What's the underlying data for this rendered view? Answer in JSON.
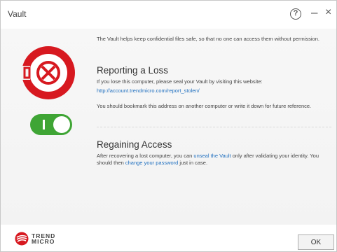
{
  "window": {
    "title": "Vault"
  },
  "titlebar": {
    "help": "?",
    "minimize": "–",
    "close": "×"
  },
  "intro": "The Vault helps keep confidential files safe, so that no one can access them without permission.",
  "reporting": {
    "heading": "Reporting a Loss",
    "text": "If you lose this computer, please seal your Vault by visiting this website:",
    "url": "http://account.trendmicro.com/report_stolen/",
    "note": "You should bookmark this address on another computer or write it down for future reference."
  },
  "regaining": {
    "heading": "Regaining Access",
    "text1": "After recovering a lost computer, you can ",
    "link1": "unseal the Vault",
    "text2": " only after validating your identity. You should then ",
    "link2": "change your password",
    "text3": " just in case."
  },
  "toggle": {
    "state": "on",
    "label": "I"
  },
  "footer": {
    "brand_line1": "TREND",
    "brand_line2": "MICRO",
    "ok_label": "OK"
  },
  "colors": {
    "brand_red": "#d71920",
    "toggle_green": "#3fa535",
    "link_blue": "#1f6fbf"
  }
}
